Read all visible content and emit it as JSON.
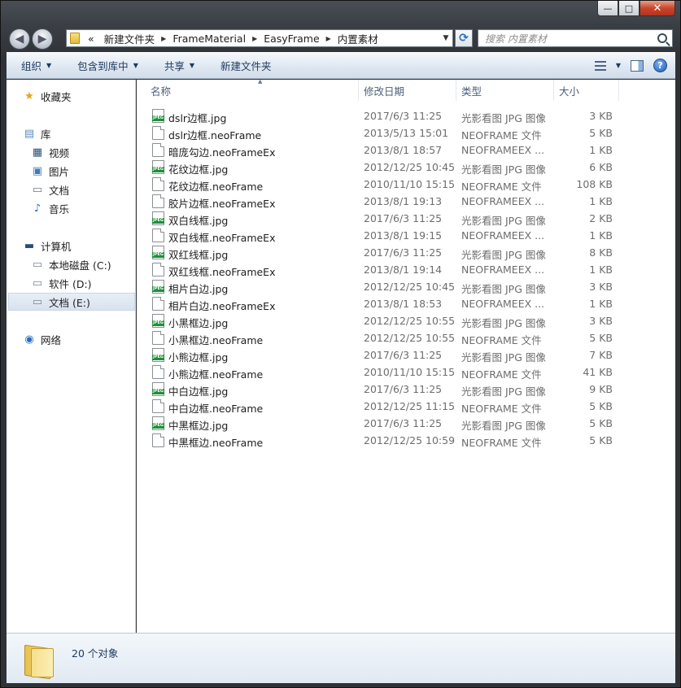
{
  "window": {
    "minimize": "—",
    "maximize": "□",
    "close": "✕"
  },
  "nav": {
    "back": "◀",
    "forward": "▶",
    "address_prefix": "«",
    "breadcrumb": [
      "新建文件夹",
      "FrameMaterial",
      "EasyFrame",
      "内置素材"
    ],
    "search_placeholder": "搜索 内置素材"
  },
  "toolbar": {
    "organize": "组织",
    "include_in_library": "包含到库中",
    "share": "共享",
    "new_folder": "新建文件夹",
    "help": "?"
  },
  "sidebar": {
    "favorites": "收藏夹",
    "libraries": "库",
    "lib_items": [
      "视频",
      "图片",
      "文档",
      "音乐"
    ],
    "computer": "计算机",
    "drives": [
      "本地磁盘 (C:)",
      "软件 (D:)",
      "文档 (E:)"
    ],
    "network": "网络"
  },
  "columns": {
    "name": "名称",
    "date": "修改日期",
    "type": "类型",
    "size": "大小"
  },
  "files": [
    {
      "name": "dslr边框.jpg",
      "date": "2017/6/3 11:25",
      "type": "光影看图 JPG 图像",
      "size": "3 KB",
      "icon": "jpeg"
    },
    {
      "name": "dslr边框.neoFrame",
      "date": "2013/5/13 15:01",
      "type": "NEOFRAME 文件",
      "size": "5 KB",
      "icon": "generic"
    },
    {
      "name": "暗庞勾边.neoFrameEx",
      "date": "2013/8/1 18:57",
      "type": "NEOFRAMEEX ...",
      "size": "1 KB",
      "icon": "generic"
    },
    {
      "name": "花纹边框.jpg",
      "date": "2012/12/25 10:45",
      "type": "光影看图 JPG 图像",
      "size": "6 KB",
      "icon": "jpeg"
    },
    {
      "name": "花纹边框.neoFrame",
      "date": "2010/11/10 15:15",
      "type": "NEOFRAME 文件",
      "size": "108 KB",
      "icon": "generic"
    },
    {
      "name": "胶片边框.neoFrameEx",
      "date": "2013/8/1 19:13",
      "type": "NEOFRAMEEX ...",
      "size": "1 KB",
      "icon": "generic"
    },
    {
      "name": "双白线框.jpg",
      "date": "2017/6/3 11:25",
      "type": "光影看图 JPG 图像",
      "size": "2 KB",
      "icon": "jpeg"
    },
    {
      "name": "双白线框.neoFrameEx",
      "date": "2013/8/1 19:15",
      "type": "NEOFRAMEEX ...",
      "size": "1 KB",
      "icon": "generic"
    },
    {
      "name": "双红线框.jpg",
      "date": "2017/6/3 11:25",
      "type": "光影看图 JPG 图像",
      "size": "8 KB",
      "icon": "jpeg"
    },
    {
      "name": "双红线框.neoFrameEx",
      "date": "2013/8/1 19:14",
      "type": "NEOFRAMEEX ...",
      "size": "1 KB",
      "icon": "generic"
    },
    {
      "name": "相片白边.jpg",
      "date": "2012/12/25 10:45",
      "type": "光影看图 JPG 图像",
      "size": "3 KB",
      "icon": "jpeg"
    },
    {
      "name": "相片白边.neoFrameEx",
      "date": "2013/8/1 18:53",
      "type": "NEOFRAMEEX ...",
      "size": "1 KB",
      "icon": "generic"
    },
    {
      "name": "小黑框边.jpg",
      "date": "2012/12/25 10:55",
      "type": "光影看图 JPG 图像",
      "size": "3 KB",
      "icon": "jpeg"
    },
    {
      "name": "小黑框边.neoFrame",
      "date": "2012/12/25 10:55",
      "type": "NEOFRAME 文件",
      "size": "5 KB",
      "icon": "generic"
    },
    {
      "name": "小熊边框.jpg",
      "date": "2017/6/3 11:25",
      "type": "光影看图 JPG 图像",
      "size": "7 KB",
      "icon": "jpeg"
    },
    {
      "name": "小熊边框.neoFrame",
      "date": "2010/11/10 15:15",
      "type": "NEOFRAME 文件",
      "size": "41 KB",
      "icon": "generic"
    },
    {
      "name": "中白边框.jpg",
      "date": "2017/6/3 11:25",
      "type": "光影看图 JPG 图像",
      "size": "9 KB",
      "icon": "jpeg"
    },
    {
      "name": "中白边框.neoFrame",
      "date": "2012/12/25 11:15",
      "type": "NEOFRAME 文件",
      "size": "5 KB",
      "icon": "generic"
    },
    {
      "name": "中黑框边.jpg",
      "date": "2017/6/3 11:25",
      "type": "光影看图 JPG 图像",
      "size": "5 KB",
      "icon": "jpeg"
    },
    {
      "name": "中黑框边.neoFrame",
      "date": "2012/12/25 10:59",
      "type": "NEOFRAME 文件",
      "size": "5 KB",
      "icon": "generic"
    }
  ],
  "status": {
    "count": "20 个对象"
  },
  "colors": {
    "selection": "#d8e2ef",
    "command_text": "#1e395b",
    "jpeg_badge": "#1e8f3a"
  }
}
